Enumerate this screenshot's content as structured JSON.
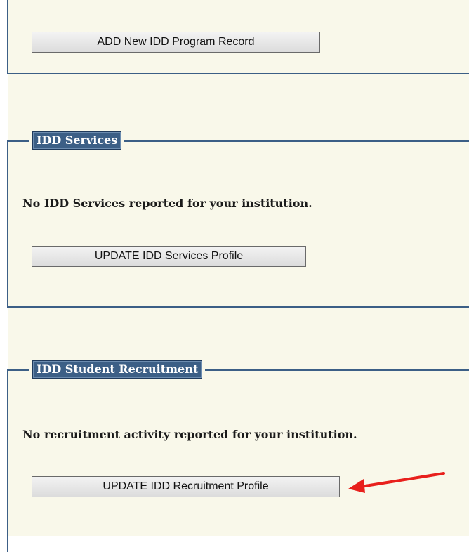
{
  "program_section": {
    "add_button_label": "ADD New IDD Program Record"
  },
  "services_section": {
    "title": "IDD Services",
    "message": "No IDD Services reported for your institution.",
    "update_button_label": "UPDATE IDD Services Profile"
  },
  "recruitment_section": {
    "title": "IDD Student Recruitment",
    "message": "No recruitment activity reported for your institution.",
    "update_button_label": "UPDATE IDD Recruitment Profile"
  },
  "annotation": {
    "arrow_color": "#e8201c"
  },
  "theme": {
    "page_background": "#f9f8ea",
    "frame_border": "#3c5f86",
    "legend_background": "#3c5f86"
  }
}
